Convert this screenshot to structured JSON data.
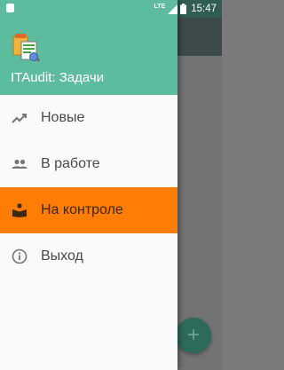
{
  "status_bar": {
    "network": "LTE",
    "time": "15:47"
  },
  "drawer": {
    "title": "ITAudit: Задачи",
    "items": [
      {
        "label": "Новые",
        "icon": "trending-up-icon"
      },
      {
        "label": "В работе",
        "icon": "people-icon"
      },
      {
        "label": "На контроле",
        "icon": "book-reader-icon",
        "active": true
      },
      {
        "label": "Выход",
        "icon": "info-icon"
      }
    ]
  },
  "fab": {
    "icon": "plus-icon",
    "glyph": "+"
  },
  "colors": {
    "header": "#5dbc9e",
    "active_item": "#ff7c05",
    "fab": "#2d6a5a"
  }
}
